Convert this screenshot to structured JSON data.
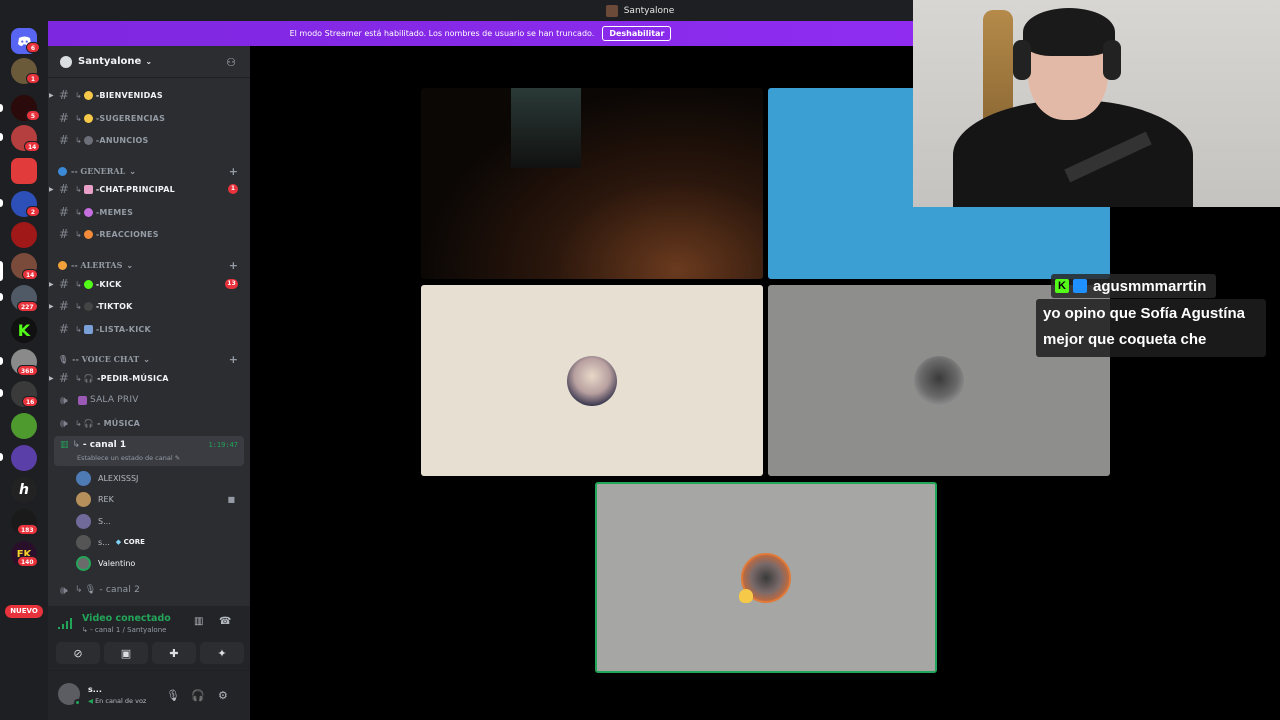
{
  "window": {
    "title": "Santyalone"
  },
  "banner": {
    "text": "El modo Streamer está habilitado. Los nombres de usuario se han truncado.",
    "button_label": "Deshabilitar"
  },
  "rail": {
    "badges": [
      "6",
      "1",
      "5",
      "14",
      "2",
      "14",
      "227",
      "368",
      "16",
      "183",
      "140"
    ],
    "nuevo_label": "NUEVO"
  },
  "guild": {
    "name": "Santyalone"
  },
  "channels": {
    "bienvenidas": "-BIENVENIDAS",
    "sugerencias": "-SUGERENCIAS",
    "anuncios": "-ANUNCIOS",
    "cat_general": "-- GENERAL",
    "chat_principal": "-CHAT-PRINCIPAL",
    "chat_principal_badge": "1",
    "memes": "-MEMES",
    "reacciones": "-REACCIONES",
    "cat_alertas": "-- ALERTAS",
    "kick": "-KICK",
    "kick_badge": "13",
    "tiktok": "-TIKTOK",
    "lista_kick": "-LISTA-KICK",
    "cat_voice": "-- VOICE CHAT",
    "pedir_musica": "-PEDIR-MÚSICA",
    "sala_priv": "SALA PRIV",
    "musica": "- MÚSICA",
    "canal1": "- canal 1",
    "canal1_time": "1:19:47",
    "canal1_status": "Establece un estado de canal",
    "canal2": "- canal 2"
  },
  "voice_users": [
    {
      "name": "ALEXISSSJ"
    },
    {
      "name": "REK"
    },
    {
      "name": "S..."
    },
    {
      "name": "s...",
      "tag": "CORE"
    },
    {
      "name": "Valentino"
    }
  ],
  "voice_panel": {
    "status": "Video conectado",
    "sub": "- canal 1 / Santyalone"
  },
  "user": {
    "name": "s...",
    "status": "En canal de voz"
  },
  "overlay_chat": {
    "username": "agusmmmarrtin",
    "message_line1": "yo opino que Sofía Agustína",
    "message_line2": "mejor que coqueta che"
  },
  "colors": {
    "banner": "#8a2be2",
    "connected": "#23a559",
    "badge": "#e8323c",
    "tile_blue": "#3c9fd4",
    "tile_cream": "#e6dfd2",
    "tile_gray": "#8e8e8c",
    "tile_speaking_border": "#23a559"
  }
}
